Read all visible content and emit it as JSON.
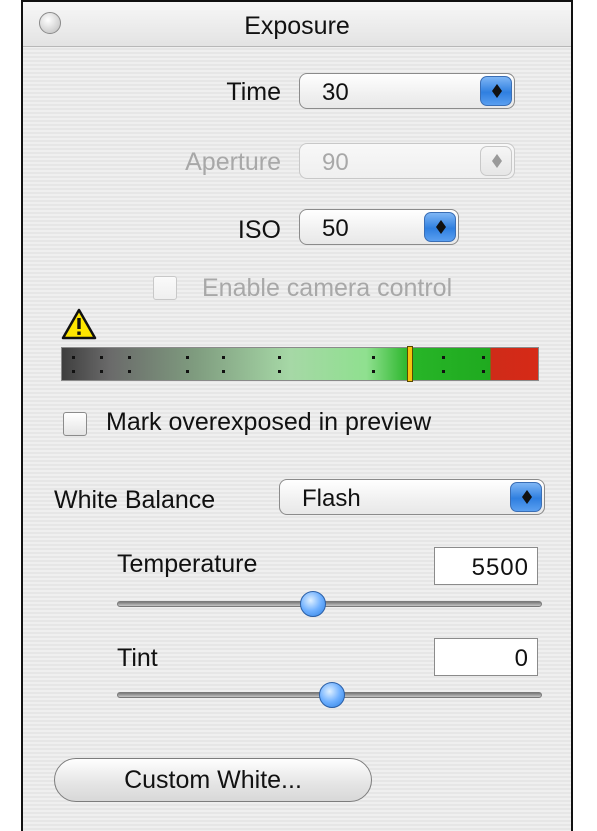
{
  "window": {
    "title": "Exposure"
  },
  "controls": {
    "time": {
      "label": "Time",
      "value": "30"
    },
    "aperture": {
      "label": "Aperture",
      "value": "90",
      "enabled": false
    },
    "iso": {
      "label": "ISO",
      "value": "50"
    },
    "camera_control": {
      "label": "Enable camera control",
      "checked": false,
      "enabled": false
    }
  },
  "histogram": {
    "warning_icon": "warning-triangle-icon",
    "marker_position_fraction": 0.73
  },
  "overexposed": {
    "label": "Mark overexposed in preview",
    "checked": false
  },
  "white_balance": {
    "label": "White Balance",
    "value": "Flash",
    "temperature": {
      "label": "Temperature",
      "value": "5500",
      "slider_fraction": 0.46
    },
    "tint": {
      "label": "Tint",
      "value": "0",
      "slider_fraction": 0.5
    }
  },
  "buttons": {
    "custom_white": "Custom White..."
  },
  "colors": {
    "accent_blue": "#2f7fe0",
    "histogram_green": "#1faa1f",
    "histogram_red": "#d62a17",
    "marker_yellow": "#f3c410"
  }
}
